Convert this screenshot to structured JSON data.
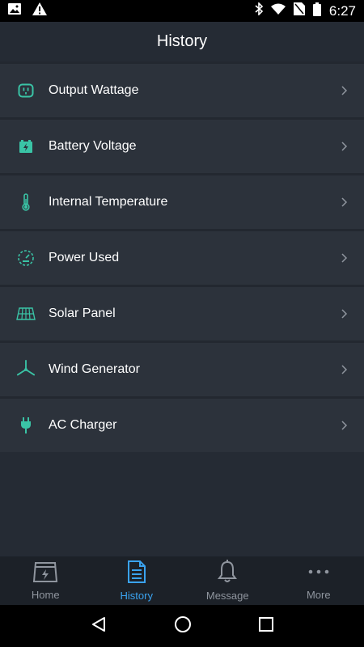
{
  "status_bar": {
    "time": "6:27",
    "left_icons": [
      "image-icon",
      "warning-icon"
    ],
    "right_icons": [
      "bluetooth-icon",
      "wifi-icon",
      "no-sim-icon",
      "battery-icon"
    ]
  },
  "header": {
    "title": "History"
  },
  "list": {
    "items": [
      {
        "label": "Output Wattage",
        "icon": "outlet-icon"
      },
      {
        "label": "Battery Voltage",
        "icon": "battery-charge-icon"
      },
      {
        "label": "Internal Temperature",
        "icon": "thermometer-icon"
      },
      {
        "label": "Power Used",
        "icon": "gauge-icon"
      },
      {
        "label": "Solar Panel",
        "icon": "solar-panel-icon"
      },
      {
        "label": "Wind Generator",
        "icon": "wind-turbine-icon"
      },
      {
        "label": "AC Charger",
        "icon": "plug-icon"
      }
    ]
  },
  "bottom_nav": {
    "active": "History",
    "items": [
      {
        "label": "Home",
        "icon": "power-station-icon"
      },
      {
        "label": "History",
        "icon": "document-icon"
      },
      {
        "label": "Message",
        "icon": "bell-icon"
      },
      {
        "label": "More",
        "icon": "more-icon"
      }
    ]
  },
  "colors": {
    "accent": "#3ac4a6",
    "active_tab": "#3aa3f0",
    "background": "#252b34",
    "row": "#2c323b"
  }
}
